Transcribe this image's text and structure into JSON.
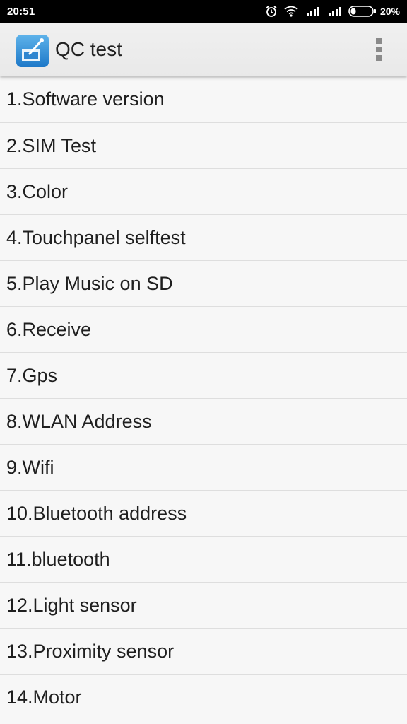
{
  "status_bar": {
    "time": "20:51",
    "icons": [
      "alarm-icon",
      "wifi-icon",
      "signal-icon",
      "signal-icon",
      "battery-icon"
    ],
    "battery_percent": "20%",
    "background": "#000000"
  },
  "app_bar": {
    "title": "QC test",
    "app_icon": "qc-test-app-icon",
    "menu_icon": "overflow-menu-icon"
  },
  "list": {
    "items": [
      {
        "label": "1.Software version"
      },
      {
        "label": "2.SIM Test"
      },
      {
        "label": "3.Color"
      },
      {
        "label": "4.Touchpanel selftest"
      },
      {
        "label": "5.Play Music on SD"
      },
      {
        "label": "6.Receive"
      },
      {
        "label": "7.Gps"
      },
      {
        "label": "8.WLAN Address"
      },
      {
        "label": "9.Wifi"
      },
      {
        "label": "10.Bluetooth address"
      },
      {
        "label": "11.bluetooth"
      },
      {
        "label": "12.Light sensor"
      },
      {
        "label": "13.Proximity sensor"
      },
      {
        "label": "14.Motor"
      }
    ]
  }
}
